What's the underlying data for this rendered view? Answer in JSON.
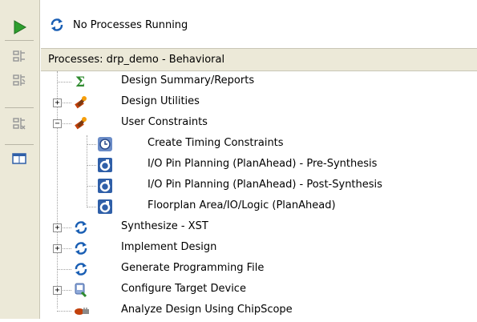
{
  "colors": {
    "toolbar_bg": "#ece9d8",
    "accent_green": "#2e9e2e",
    "refresh_blue": "#1a5fb4"
  },
  "status": {
    "text": "No Processes Running",
    "icon": "refresh-icon"
  },
  "header": {
    "title": "Processes: drp_demo - Behavioral"
  },
  "toolbar": {
    "buttons": [
      "run-icon",
      "rerun-icon",
      "rerun-all-icon",
      "stop-icon",
      "window-icon"
    ]
  },
  "tree": {
    "items": [
      {
        "label": "Design Summary/Reports",
        "icon": "sigma-icon",
        "expander": ""
      },
      {
        "label": "Design Utilities",
        "icon": "tools-icon",
        "expander": "+"
      },
      {
        "label": "User Constraints",
        "icon": "tools-icon",
        "expander": "-"
      },
      {
        "label": "Create Timing Constraints",
        "icon": "clock-icon",
        "expander": ""
      },
      {
        "label": "I/O Pin Planning (PlanAhead) - Pre-Synthesis",
        "icon": "planahead-icon",
        "expander": ""
      },
      {
        "label": "I/O Pin Planning (PlanAhead) - Post-Synthesis",
        "icon": "planahead-icon",
        "expander": ""
      },
      {
        "label": "Floorplan Area/IO/Logic (PlanAhead)",
        "icon": "planahead-icon",
        "expander": ""
      },
      {
        "label": "Synthesize - XST",
        "icon": "refresh-icon",
        "expander": "+"
      },
      {
        "label": "Implement Design",
        "icon": "refresh-icon",
        "expander": "+"
      },
      {
        "label": "Generate Programming File",
        "icon": "refresh-icon",
        "expander": ""
      },
      {
        "label": "Configure Target Device",
        "icon": "device-icon",
        "expander": "+"
      },
      {
        "label": "Analyze Design Using ChipScope",
        "icon": "chipscope-icon",
        "expander": ""
      }
    ]
  }
}
